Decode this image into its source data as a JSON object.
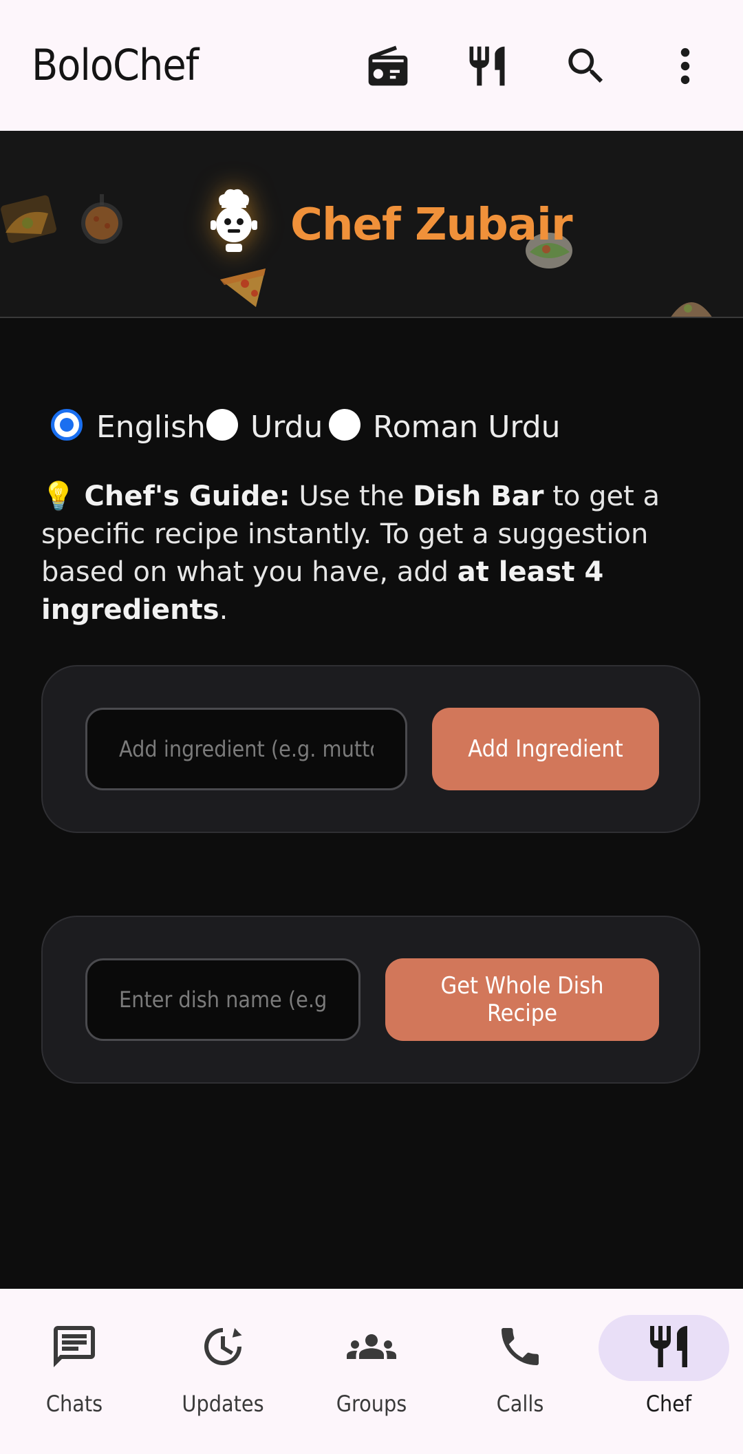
{
  "appbar": {
    "title": "BoloChef",
    "icons": [
      "radio-icon",
      "restaurant-icon",
      "search-icon",
      "more-vert-icon"
    ]
  },
  "banner": {
    "title": "Chef Zubair",
    "title_color": "#f0913a",
    "avatar_icon": "chef-robot-icon"
  },
  "language": {
    "options": [
      {
        "label": "English",
        "selected": true
      },
      {
        "label": "Urdu",
        "selected": false
      },
      {
        "label": "Roman Urdu",
        "selected": false
      }
    ]
  },
  "guide": {
    "emoji": "💡",
    "heading": "Chef's Guide:",
    "part1": " Use the ",
    "dish_bar": "Dish Bar",
    "part2": " to get a specific recipe instantly. To get a suggestion based on what you have, add ",
    "at_least": "at least 4 ingredients",
    "part3": "."
  },
  "ingredient_card": {
    "input_placeholder": "Add ingredient (e.g. mutton)",
    "input_value": "",
    "button_label": "Add Ingredient"
  },
  "dish_card": {
    "input_placeholder": "Enter dish name (e.g. Biryani)",
    "input_value": "",
    "button_label": "Get Whole Dish Recipe"
  },
  "bottom_nav": {
    "items": [
      {
        "label": "Chats",
        "icon": "chat-icon"
      },
      {
        "label": "Updates",
        "icon": "updates-icon"
      },
      {
        "label": "Groups",
        "icon": "groups-icon"
      },
      {
        "label": "Calls",
        "icon": "phone-icon"
      },
      {
        "label": "Chef",
        "icon": "restaurant-icon",
        "active": true
      }
    ]
  },
  "colors": {
    "accent": "#d2775a",
    "radio_selected": "#1a6ff0",
    "nav_active_pill": "#e9dff7"
  }
}
